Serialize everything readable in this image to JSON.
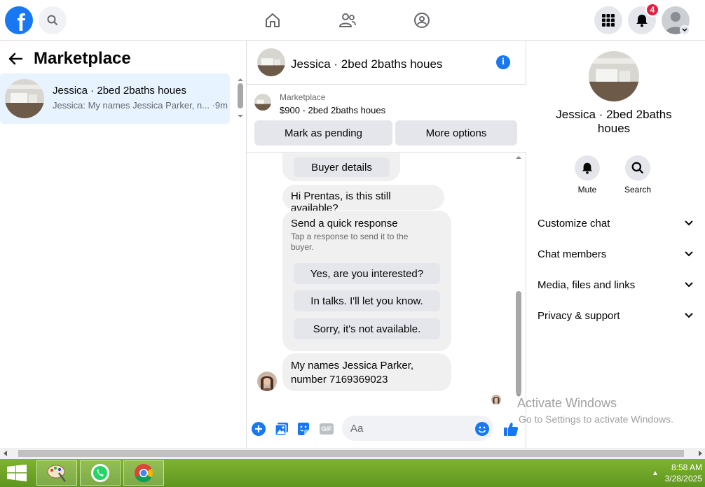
{
  "topbar": {
    "logo_letter": "f",
    "notification_count": "4"
  },
  "left": {
    "title": "Marketplace",
    "conversations": [
      {
        "name": "Jessica · 2bed 2baths houes",
        "snippet": "Jessica: My names Jessica Parker, n... ·9m"
      }
    ]
  },
  "chat": {
    "header_name": "Jessica · 2bed 2baths houes",
    "listing_category": "Marketplace",
    "listing_title": "$900 - 2bed 2baths houes",
    "mark_pending_label": "Mark as pending",
    "more_options_label": "More options",
    "buyer_details_label": "Buyer details",
    "msg_available": "Hi Prentas, is this still available?",
    "quick_title": "Send a quick response",
    "quick_sub": "Tap a response to send it to the buyer.",
    "quick_options": [
      "Yes, are you interested?",
      "In talks. I'll let you know.",
      "Sorry, it's not available."
    ],
    "msg_name_line1": "My names Jessica Parker,",
    "msg_name_line2": "number 7169369023",
    "composer_placeholder": "Aa",
    "gif_label": "GIF"
  },
  "right": {
    "name": "Jessica · 2bed 2baths houes",
    "mute_label": "Mute",
    "search_label": "Search",
    "rows": [
      "Customize chat",
      "Chat members",
      "Media, files and links",
      "Privacy & support"
    ]
  },
  "watermark": {
    "line1": "Activate Windows",
    "line2": "Go to Settings to activate Windows."
  },
  "taskbar": {
    "time": "8:58 AM",
    "date": "3/28/2025"
  },
  "colors": {
    "accent": "#1877f2",
    "badge": "#e41e3f",
    "taskbar": "#6fa527"
  }
}
